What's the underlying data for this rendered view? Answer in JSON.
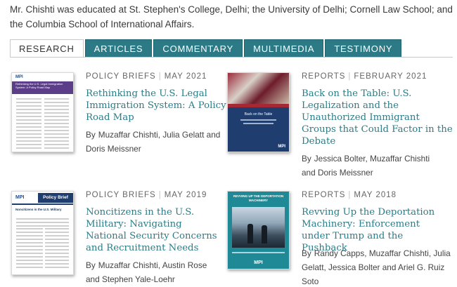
{
  "bio": "Mr. Chishti was educated at St. Stephen's College, Delhi; the University of Delhi; Cornell Law School; and the Columbia School of International Affairs.",
  "tabs": [
    "RESEARCH",
    "ARTICLES",
    "COMMENTARY",
    "MULTIMEDIA",
    "TESTIMONY"
  ],
  "active_tab": "RESEARCH",
  "colors": {
    "accent": "#2b7a86",
    "title_link": "#2a7d88",
    "purple_band": "#5b3d8a",
    "navy": "#1f3d6e"
  },
  "cards": [
    {
      "type": "POLICY BRIEFS",
      "date": "MAY 2021",
      "title": "Rethinking the U.S. Legal Immigration System: A Policy Road Map",
      "by": "By",
      "authors": "Muzaffar Chishti, Julia Gelatt and Doris Meissner",
      "thumb_logo": "MPI",
      "thumb_title": "Rethinking the U.S. Legal Immigration System: A Policy Road Map"
    },
    {
      "type": "REPORTS",
      "date": "FEBRUARY 2021",
      "title": "Back on the Table: U.S. Legalization and the Unauthorized Immigrant Groups that Could Factor in the Debate",
      "by": "By",
      "authors": "Jessica Bolter, Muzaffar Chishti and Doris Meissner",
      "thumb_logo": "MPI",
      "thumb_title": "Back on the Table"
    },
    {
      "type": "POLICY BRIEFS",
      "date": "MAY 2019",
      "title": "Noncitizens in the U.S. Military: Navigating National Security Concerns and Recruitment Needs",
      "by": "By",
      "authors": "Muzaffar Chishti, Austin Rose and Stephen Yale-Loehr",
      "thumb_logo": "MPI",
      "thumb_badge": "Policy Brief",
      "thumb_title": "Noncitizens in the U.S. Military"
    },
    {
      "type": "REPORTS",
      "date": "MAY 2018",
      "title": "Revving Up the Deportation Machinery: Enforcement under Trump and the Pushback",
      "by": "By",
      "authors": "Randy Capps, Muzaffar Chishti, Julia Gelatt, Jessica Bolter and Ariel G. Ruiz Soto",
      "thumb_logo": "MPI",
      "thumb_title": "REVVING UP THE DEPORTATION MACHINERY"
    }
  ]
}
